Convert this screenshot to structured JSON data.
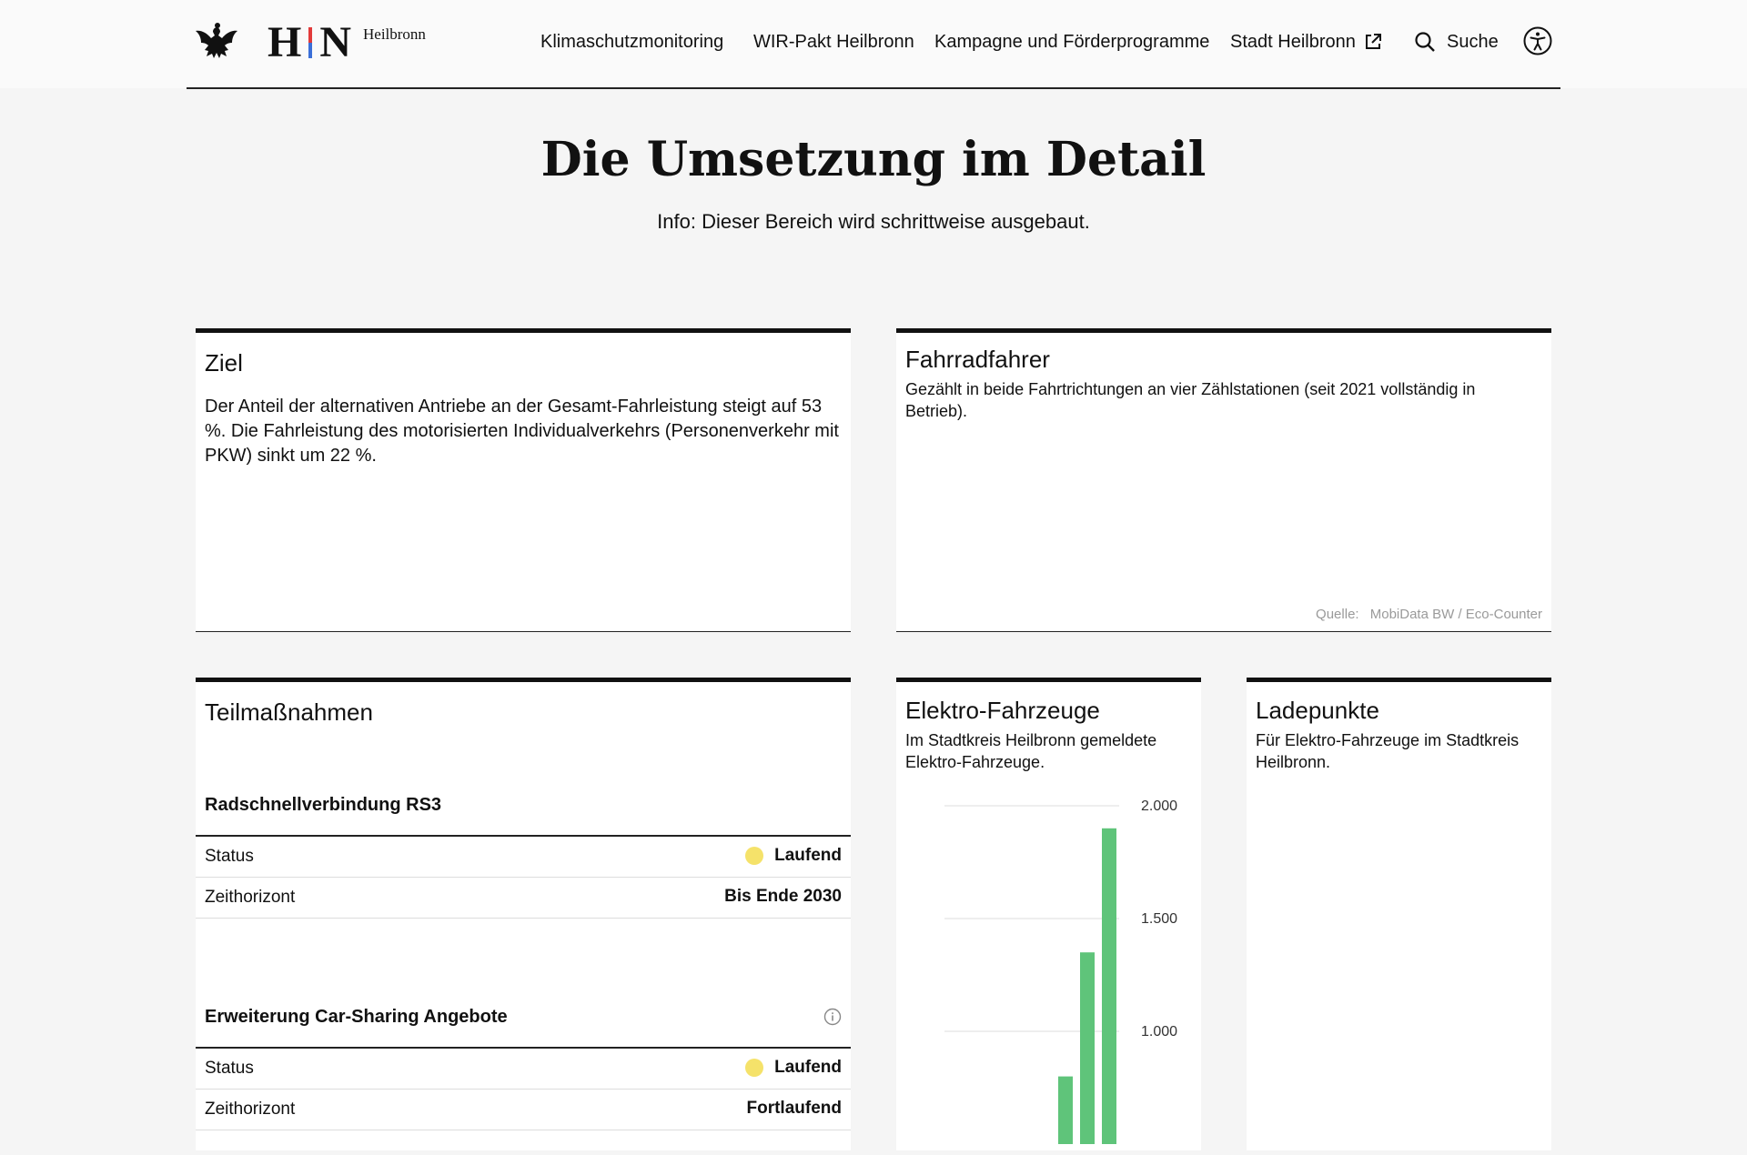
{
  "header": {
    "logo_letters": [
      "H",
      "N"
    ],
    "logo_city": "Heilbronn",
    "nav": [
      {
        "label": "Klimaschutzmonitoring"
      },
      {
        "label": "WIR-Pakt Heilbronn"
      },
      {
        "label": "Kampagne und Förderprogramme"
      },
      {
        "label": "Stadt Heilbronn",
        "icon": "external-link-icon"
      }
    ],
    "search_label": "Suche",
    "icons": [
      "eagle-icon",
      "external-link-icon",
      "search-icon",
      "accessibility-icon"
    ]
  },
  "hero": {
    "title": "Die Umsetzung im Detail",
    "info": "Info: Dieser Bereich wird schrittweise ausgebaut."
  },
  "ziel": {
    "title": "Ziel",
    "text": "Der Anteil der alternativen Antriebe an der Gesamt-Fahrleistung steigt auf 53 %. Die Fahrleistung des motorisierten Individualverkehrs (Personenverkehr mit PKW) sinkt um 22 %."
  },
  "fahrrad": {
    "title": "Fahrradfahrer",
    "desc": "Gezählt in beide Fahrtrichtungen an vier Zählstationen (seit 2021 vollständig in Betrieb).",
    "source_label": "Quelle:",
    "source_value": "MobiData BW / Eco-Counter"
  },
  "measures": {
    "title": "Teilmaßnahmen",
    "items": [
      {
        "name": "Radschnellverbindung RS3",
        "status_label": "Status",
        "status_value": "Laufend",
        "horizon_label": "Zeithorizont",
        "horizon_value": "Bis Ende 2030"
      },
      {
        "name": "Erweiterung Car-Sharing Angebote",
        "status_label": "Status",
        "status_value": "Laufend",
        "horizon_label": "Zeithorizont",
        "horizon_value": "Fortlaufend"
      }
    ],
    "status_color": "#f5e26a"
  },
  "ev": {
    "title": "Elektro-Fahrzeuge",
    "desc_lines": [
      "Im Stadtkreis Heilbronn gemeldete",
      "Elektro-Fahrzeuge."
    ]
  },
  "lade": {
    "title": "Ladepunkte",
    "desc_lines": [
      "Für Elektro-Fahrzeuge im Stadtkreis",
      "Heilbronn."
    ]
  },
  "chart_data": {
    "type": "bar",
    "values": [
      800,
      1350,
      1900
    ],
    "ylim": [
      500,
      2000
    ],
    "yticks": [
      2000,
      1500,
      1000
    ],
    "ytick_labels": [
      "2.000",
      "1.500",
      "1.000"
    ],
    "grid": true,
    "bar_color": "#5fc47a"
  }
}
